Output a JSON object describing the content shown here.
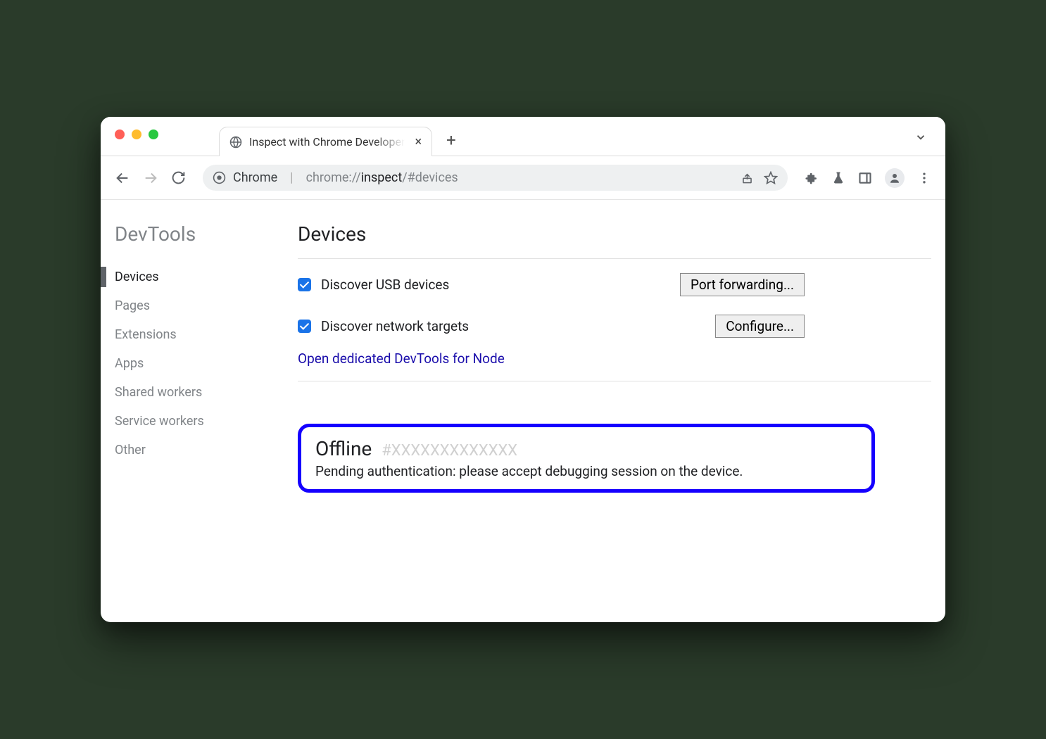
{
  "window": {
    "tab_title": "Inspect with Chrome Developer"
  },
  "omnibox": {
    "source_label": "Chrome",
    "url_prefix": "chrome://",
    "url_path": "inspect",
    "url_suffix": "/#devices"
  },
  "sidebar": {
    "title": "DevTools",
    "items": [
      {
        "label": "Devices",
        "active": true
      },
      {
        "label": "Pages",
        "active": false
      },
      {
        "label": "Extensions",
        "active": false
      },
      {
        "label": "Apps",
        "active": false
      },
      {
        "label": "Shared workers",
        "active": false
      },
      {
        "label": "Service workers",
        "active": false
      },
      {
        "label": "Other",
        "active": false
      }
    ]
  },
  "main": {
    "title": "Devices",
    "usb_label": "Discover USB devices",
    "usb_button": "Port forwarding...",
    "network_label": "Discover network targets",
    "network_button": "Configure...",
    "node_link": "Open dedicated DevTools for Node",
    "device": {
      "status": "Offline",
      "id": "#XXXXXXXXXXXXX",
      "message": "Pending authentication: please accept debugging session on the device."
    }
  }
}
